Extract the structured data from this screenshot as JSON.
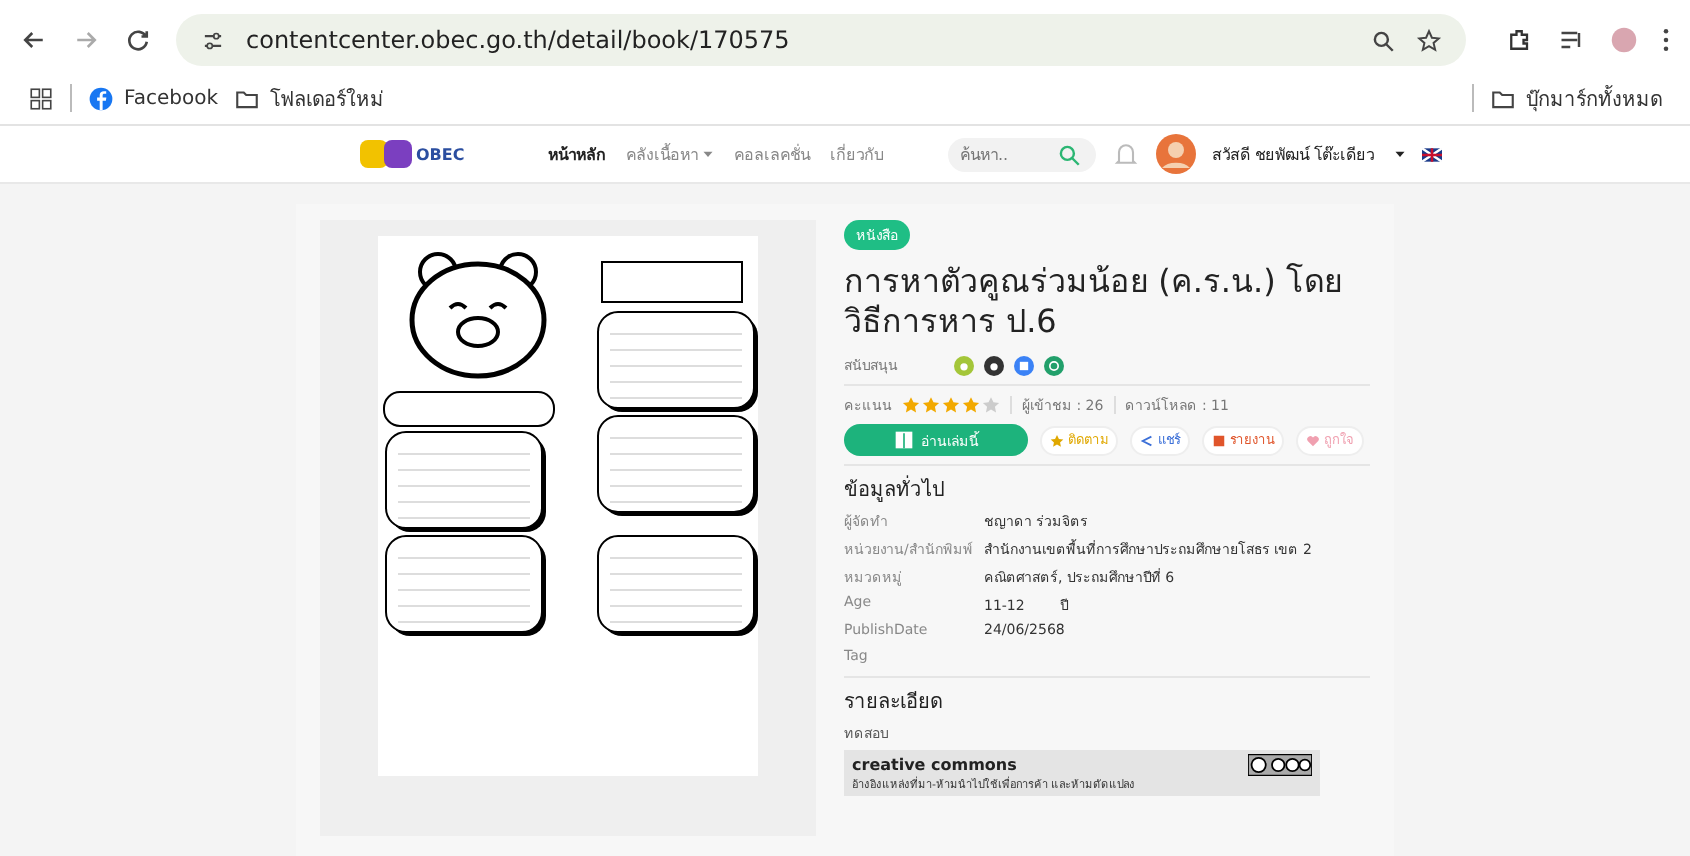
{
  "browser": {
    "url": "contentcenter.obec.go.th/detail/book/170575",
    "bookmarks": [
      "Facebook",
      "โฟลเดอร์ใหม่"
    ],
    "all_bookmarks": "บุ๊กมาร์กทั้งหมด"
  },
  "site": {
    "logo": "OBEC",
    "nav": [
      {
        "label": "หน้าหลัก",
        "selected": true,
        "dropdown": false
      },
      {
        "label": "คลังเนื้อหา",
        "selected": false,
        "dropdown": true
      },
      {
        "label": "คอลเลคชั่น",
        "selected": false,
        "dropdown": false
      },
      {
        "label": "เกี่ยวกับ",
        "selected": false,
        "dropdown": false
      }
    ],
    "search": {
      "placeholder": "ค้นหา.."
    },
    "user": "สวัสดี ชยพัฒน์ โต๊ะเดียว"
  },
  "book": {
    "badge": "หนังสือ",
    "title": "การหาตัวคูณร่วมน้อย (ค.ร.น.) โดยวิธีการหาร ป.6",
    "support_label": "สนับสนุน",
    "platforms": [
      {
        "kind": "android",
        "color": "#a4c639"
      },
      {
        "kind": "apple",
        "color": "#333333"
      },
      {
        "kind": "windows",
        "color": "#3b82f6"
      },
      {
        "kind": "web",
        "color": "#22a06b"
      }
    ],
    "rating_label": "คะแนน",
    "stars": 4,
    "views": "ผู้เข้าชม : 26",
    "downloads": "ดาวน์โหลด : 11",
    "read_button": "อ่านเล่มนี้",
    "actions": [
      {
        "kind": "follow",
        "label": "ติดตาม",
        "color": "#e0a800"
      },
      {
        "kind": "share",
        "label": "แชร์",
        "color": "#3b6fd8"
      },
      {
        "kind": "report",
        "label": "รายงาน",
        "color": "#e0552b"
      },
      {
        "kind": "like",
        "label": "ถูกใจ",
        "color": "#f0a0b0"
      }
    ],
    "general_heading": "ข้อมูลทั่วไป",
    "info": [
      {
        "label": "ผู้จัดทำ",
        "value": "ชญาดา ร่วมจิตร"
      },
      {
        "label": "หน่วยงาน/สำนักพิมพ์",
        "value": "สำนักงานเขตพื้นที่การศึกษาประถมศึกษายโสธร เขต 2"
      },
      {
        "label": "หมวดหมู่",
        "value": "คณิตศาสตร์, ประถมศึกษาปีที่ 6"
      },
      {
        "label": "Age",
        "value": "11-12        ปี"
      },
      {
        "label": "PublishDate",
        "value": "24/06/2568"
      },
      {
        "label": "Tag"
      }
    ],
    "detail_heading": "รายละเอียด",
    "detail": "ทดสอบ",
    "license": {
      "logo": "creative commons",
      "text": "อ้างอิงแหล่งที่มา-ห้ามนำไปใช้เพื่อการค้า และห้ามดัดแปลง"
    }
  }
}
